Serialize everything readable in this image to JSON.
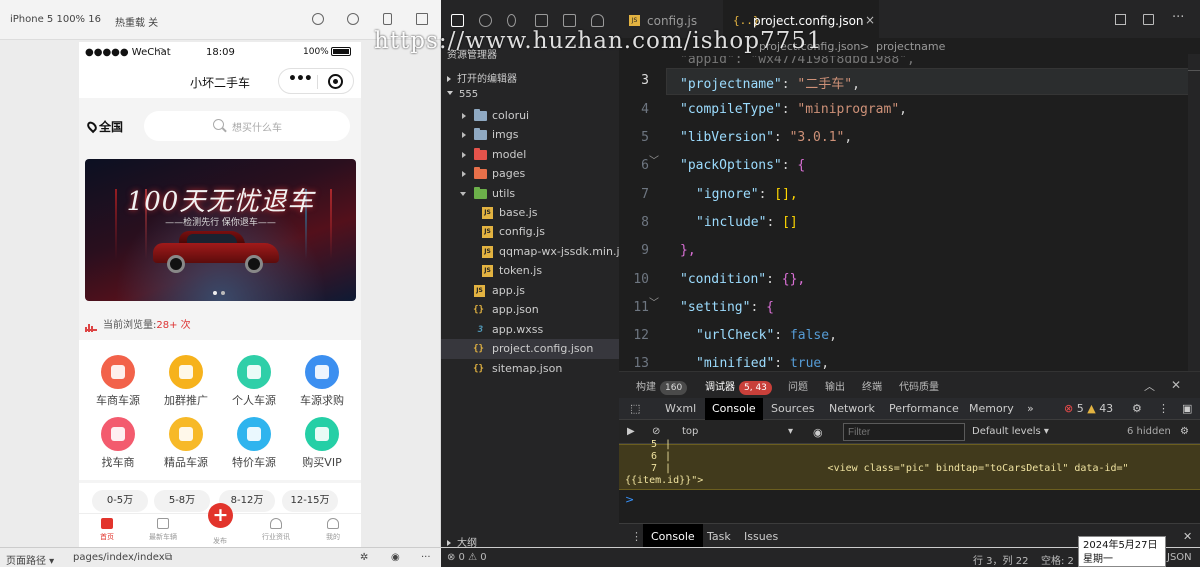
{
  "simulator": {
    "device": "iPhone 5 100% 16",
    "hot_reload": "热重载 关",
    "colors": {
      "accent": "#e2342c"
    }
  },
  "phone": {
    "status": {
      "carrier": "●●●●● WeChat",
      "wifi_icon": "wifi-icon",
      "time": "18:09",
      "battery": "100%"
    },
    "nav_title": "小坏二手车",
    "capsule_dots": "•••",
    "city": "全国",
    "search_placeholder": "想买什么车",
    "banner": {
      "title": "100天无忧退车",
      "subtitle": "——检测先行 保你退车——"
    },
    "views": {
      "label": "当前浏览量:",
      "count": "28+ 次"
    },
    "grid": [
      {
        "label": "车商车源",
        "color": "#f2624a"
      },
      {
        "label": "加群推广",
        "color": "#f6b21c"
      },
      {
        "label": "个人车源",
        "color": "#2fcfa8"
      },
      {
        "label": "车源求购",
        "color": "#3c8ff0"
      },
      {
        "label": "找车商",
        "color": "#f35b6e"
      },
      {
        "label": "精品车源",
        "color": "#f7b928"
      },
      {
        "label": "特价车源",
        "color": "#2fb4ee"
      },
      {
        "label": "购买VIP",
        "color": "#25cfa6"
      }
    ],
    "prices": [
      "0-5万",
      "5-8万",
      "8-12万",
      "12-15万"
    ],
    "tabbar": [
      {
        "label": "首页"
      },
      {
        "label": "最新车辆"
      },
      {
        "label": "发布"
      },
      {
        "label": "行业资讯"
      },
      {
        "label": "我的"
      }
    ],
    "publish_symbol": "+"
  },
  "explorer": {
    "section_header": "资源管理器",
    "open_editors": "打开的编辑器",
    "project": "555",
    "tree": [
      {
        "label": "colorui",
        "type": "folder",
        "color": "#8fa9c2"
      },
      {
        "label": "imgs",
        "type": "folder",
        "color": "#8fa9c2"
      },
      {
        "label": "model",
        "type": "folder",
        "color": "#e5534b"
      },
      {
        "label": "pages",
        "type": "folder",
        "color": "#e8704a"
      },
      {
        "label": "utils",
        "type": "folder",
        "color": "#6cb04a"
      },
      {
        "label": "base.js",
        "type": "js",
        "glyph": "JS"
      },
      {
        "label": "config.js",
        "type": "js",
        "glyph": "JS"
      },
      {
        "label": "qqmap-wx-jssdk.min.js",
        "type": "js",
        "glyph": "JS"
      },
      {
        "label": "token.js",
        "type": "js",
        "glyph": "JS"
      },
      {
        "label": "app.js",
        "type": "js",
        "glyph": "JS"
      },
      {
        "label": "app.json",
        "type": "json",
        "glyph": "{}"
      },
      {
        "label": "app.wxss",
        "type": "wxss",
        "glyph": "3"
      },
      {
        "label": "project.config.json",
        "type": "json",
        "glyph": "{}"
      },
      {
        "label": "sitemap.json",
        "type": "json",
        "glyph": "{}"
      }
    ],
    "outline": "大纲",
    "problems": "⊗ 0 ⚠ 0"
  },
  "editor": {
    "tabs": [
      {
        "label": "config.js",
        "glyph": "JS"
      },
      {
        "label": "project.config.json",
        "glyph": "{..}"
      }
    ],
    "breadcrumb": {
      "file": "project.config.json",
      "sep": ">",
      "node": "projectname"
    },
    "lines": [
      {
        "n": "",
        "t": "\"appid\": \"wx4774198f8dbd1988\","
      },
      {
        "n": "3",
        "k": "\"projectname\"",
        "v": "\"二手车\"",
        "end": ","
      },
      {
        "n": "4",
        "k": "\"compileType\"",
        "v": "\"miniprogram\"",
        "end": ","
      },
      {
        "n": "5",
        "k": "\"libVersion\"",
        "v": "\"3.0.1\"",
        "end": ","
      },
      {
        "n": "6",
        "k": "\"packOptions\"",
        "open": "{"
      },
      {
        "n": "7",
        "k": "\"ignore\"",
        "raw": "[],"
      },
      {
        "n": "8",
        "k": "\"include\"",
        "raw": "[]"
      },
      {
        "n": "9",
        "close": "},"
      },
      {
        "n": "10",
        "k": "\"condition\"",
        "raw": "{},"
      },
      {
        "n": "11",
        "k": "\"setting\"",
        "open": "{"
      },
      {
        "n": "12",
        "k": "\"urlCheck\"",
        "bool": "false",
        "end": ","
      },
      {
        "n": "13",
        "k": "\"minified\"",
        "bool": "true",
        "end": ","
      }
    ]
  },
  "devtools": {
    "top_tabs": [
      {
        "label": "构建",
        "badge": "160"
      },
      {
        "label": "调试器",
        "badge": "5, 43"
      },
      {
        "label": "问题"
      },
      {
        "label": "输出"
      },
      {
        "label": "终端"
      },
      {
        "label": "代码质量"
      }
    ],
    "panel_tabs": [
      "Wxml",
      "Console",
      "Sources",
      "Network",
      "Performance",
      "Memory",
      "»"
    ],
    "errors": "5",
    "warnings": "43",
    "context": "top",
    "filter_placeholder": "Filter",
    "levels": "Default levels ▾",
    "hidden": "6 hidden",
    "messages": [
      {
        "ln": "5",
        "code": "|"
      },
      {
        "ln": "6",
        "code": "|"
      },
      {
        "ln": "7",
        "code": "|                          <view class=\"pic\" bindtap=\"toCarsDetail\" data-id=\""
      },
      {
        "ln": "",
        "code": "{{item.id}}\">"
      }
    ],
    "prompt": ">",
    "drawer_tabs": [
      "Console",
      "Task",
      "Issues"
    ]
  },
  "statusbar": {
    "page_path_label": "页面路径 ▾",
    "page_path": "pages/index/index",
    "cursor": "行 3，列 22",
    "spaces": "空格: 2",
    "lang": "JSON"
  },
  "clock": {
    "date": "2024年5月27日",
    "weekday": "星期一"
  },
  "watermark": "https://www.huzhan.com/ishop7751"
}
